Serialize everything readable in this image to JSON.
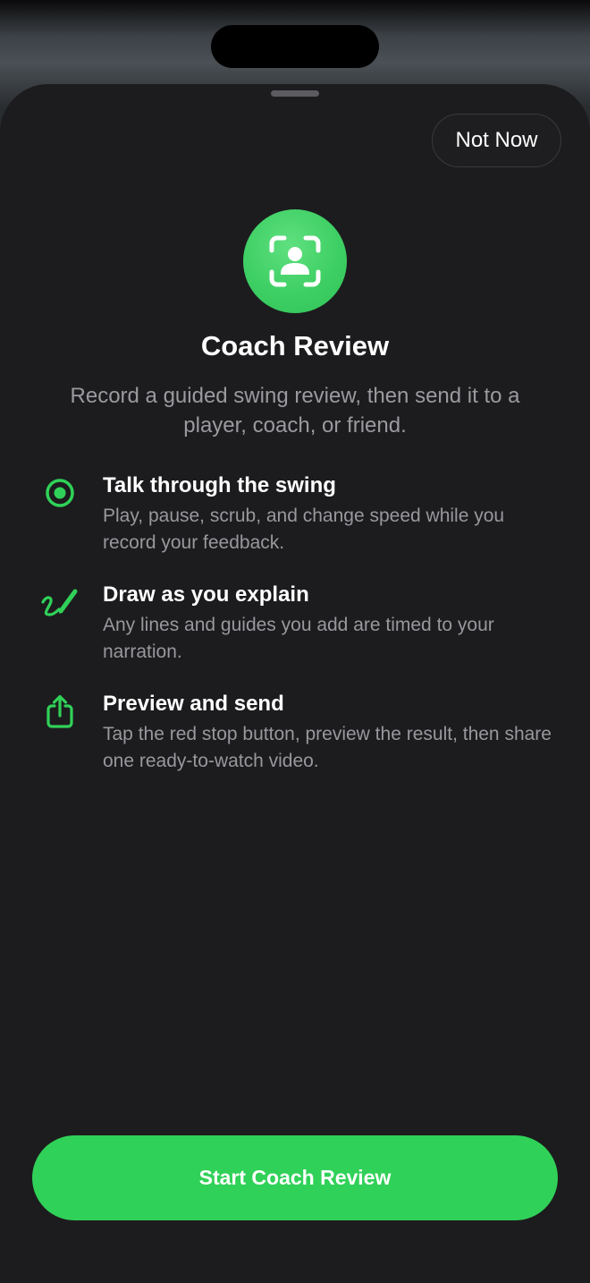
{
  "sheet": {
    "dismiss_label": "Not Now",
    "hero_icon": "person-viewfinder-icon",
    "title": "Coach Review",
    "subtitle": "Record a guided swing review, then send it to a player, coach, or friend."
  },
  "features": [
    {
      "icon": "record-circle-icon",
      "title": "Talk through the swing",
      "description": "Play, pause, scrub, and change speed while you record your feedback."
    },
    {
      "icon": "scribble-pencil-icon",
      "title": "Draw as you explain",
      "description": "Any lines and guides you add are timed to your narration."
    },
    {
      "icon": "share-icon",
      "title": "Preview and send",
      "description": "Tap the red stop button, preview the result, then share one ready-to-watch video."
    }
  ],
  "primary_action": {
    "label": "Start Coach Review"
  },
  "colors": {
    "accent": "#30d158",
    "sheet_background": "#1c1c1e",
    "secondary_text": "#98989d"
  }
}
